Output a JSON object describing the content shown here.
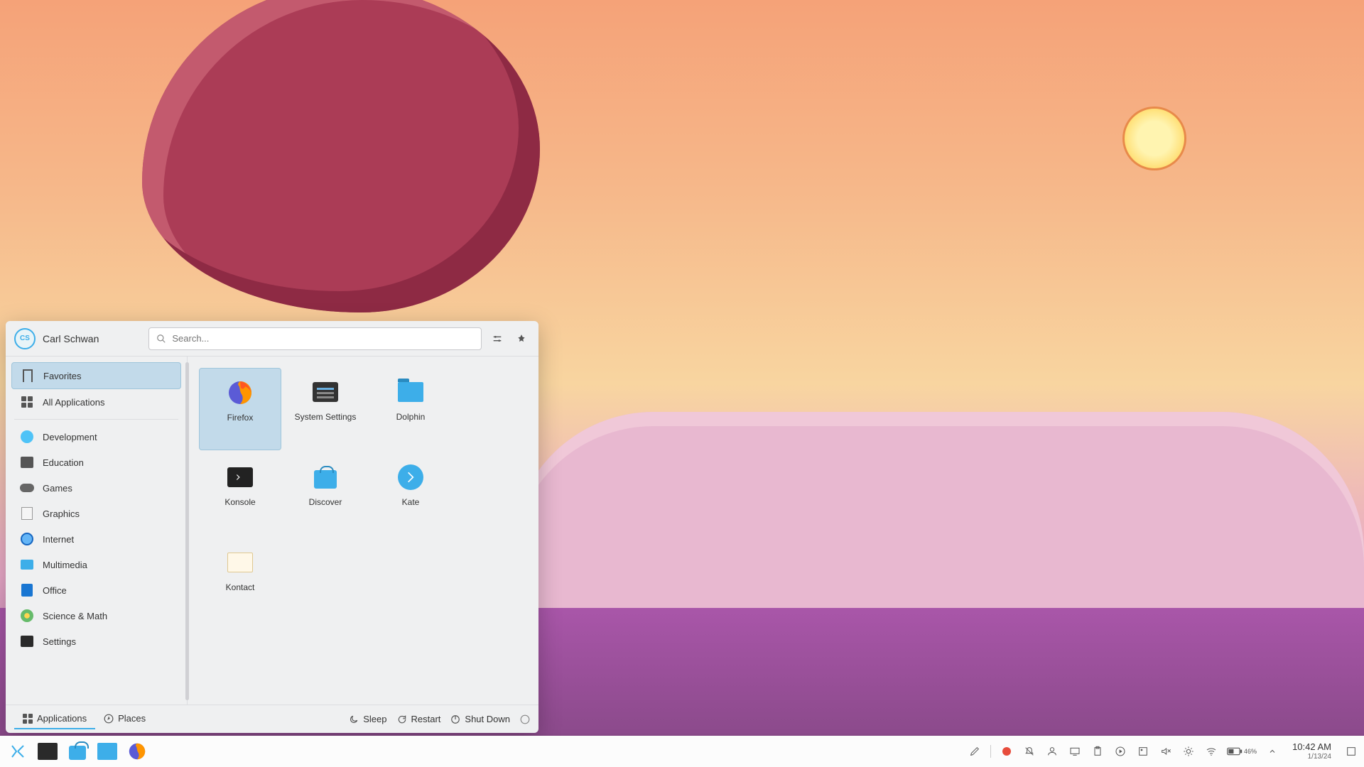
{
  "launcher": {
    "user": {
      "name": "Carl Schwan",
      "initials": "CS"
    },
    "search": {
      "placeholder": "Search..."
    },
    "sidebar": {
      "builtin": [
        {
          "label": "Favorites",
          "active": true,
          "icon": "bookmark"
        },
        {
          "label": "All Applications",
          "active": false,
          "icon": "grid"
        }
      ],
      "categories": [
        {
          "label": "Development",
          "icon": "dev"
        },
        {
          "label": "Education",
          "icon": "edu"
        },
        {
          "label": "Games",
          "icon": "games"
        },
        {
          "label": "Graphics",
          "icon": "gfx"
        },
        {
          "label": "Internet",
          "icon": "globe"
        },
        {
          "label": "Multimedia",
          "icon": "media"
        },
        {
          "label": "Office",
          "icon": "office"
        },
        {
          "label": "Science & Math",
          "icon": "sci"
        },
        {
          "label": "Settings",
          "icon": "gear"
        }
      ]
    },
    "apps": [
      {
        "label": "Firefox",
        "icon": "firefox",
        "selected": true
      },
      {
        "label": "System Settings",
        "icon": "settings",
        "selected": false
      },
      {
        "label": "Dolphin",
        "icon": "folder",
        "selected": false
      },
      {
        "label": "Konsole",
        "icon": "terminal",
        "selected": false
      },
      {
        "label": "Discover",
        "icon": "bag",
        "selected": false
      },
      {
        "label": "Kate",
        "icon": "kate",
        "selected": false
      },
      {
        "label": "Kontact",
        "icon": "kontact",
        "selected": false
      }
    ],
    "footer": {
      "tabs": [
        {
          "label": "Applications",
          "active": true,
          "icon": "grid"
        },
        {
          "label": "Places",
          "active": false,
          "icon": "compass"
        }
      ],
      "actions": [
        {
          "label": "Sleep",
          "icon": "moon"
        },
        {
          "label": "Restart",
          "icon": "refresh"
        },
        {
          "label": "Shut Down",
          "icon": "power"
        }
      ]
    }
  },
  "taskbar": {
    "pinned": [
      {
        "name": "launcher",
        "icon": "kde"
      },
      {
        "name": "text-editor",
        "icon": "textedit"
      },
      {
        "name": "discover",
        "icon": "discover-small"
      },
      {
        "name": "file-manager",
        "icon": "filemgr"
      },
      {
        "name": "firefox",
        "icon": "firefox-small"
      }
    ],
    "tray": [
      "pencil",
      "record",
      "notifications-muted",
      "user",
      "display",
      "clipboard",
      "media-play",
      "image",
      "volume-muted",
      "brightness",
      "wifi",
      "battery-46",
      "chevron-up"
    ],
    "battery_label": "46%",
    "clock": {
      "time": "10:42 AM",
      "date": "1/13/24"
    }
  }
}
